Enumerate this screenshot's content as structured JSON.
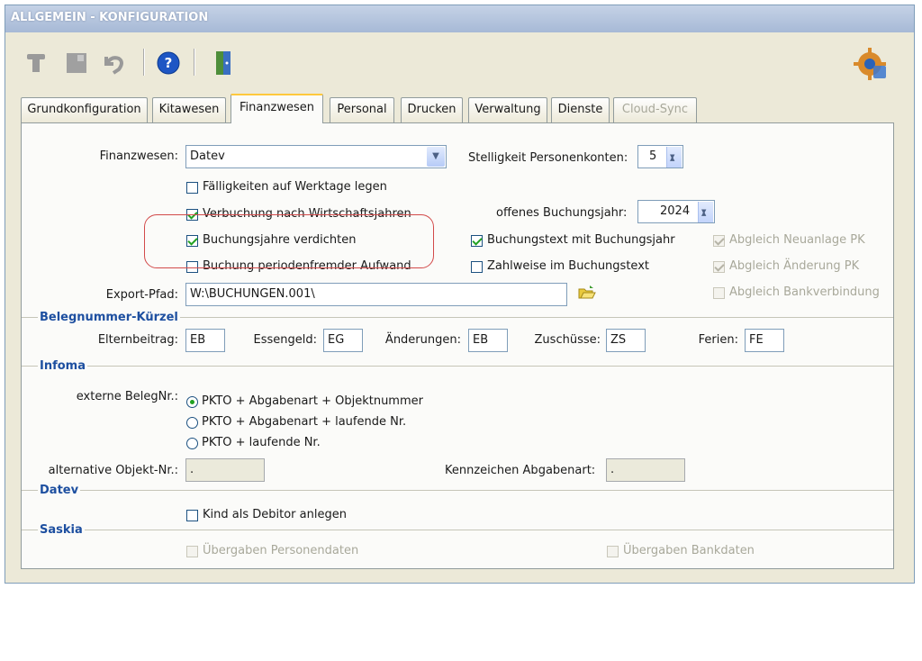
{
  "window": {
    "title": "ALLGEMEIN - KONFIGURATION"
  },
  "toolbar": {
    "icons": [
      "user-icon",
      "save-icon",
      "undo-icon",
      "help-icon",
      "exit-door-icon",
      "settings-gear-icon"
    ]
  },
  "tabs": [
    {
      "label": "Grundkonfiguration",
      "active": false,
      "enabled": true
    },
    {
      "label": "Kitawesen",
      "active": false,
      "enabled": true
    },
    {
      "label": "Finanzwesen",
      "active": true,
      "enabled": true
    },
    {
      "label": "Personal",
      "active": false,
      "enabled": true
    },
    {
      "label": "Drucken",
      "active": false,
      "enabled": true
    },
    {
      "label": "Verwaltung",
      "active": false,
      "enabled": true
    },
    {
      "label": "Dienste",
      "active": false,
      "enabled": true
    },
    {
      "label": "Cloud-Sync",
      "active": false,
      "enabled": false
    }
  ],
  "finanz": {
    "finanzwesen_label": "Finanzwesen:",
    "finanzwesen_value": "Datev",
    "stelligkeit_label": "Stelligkeit Personenkonten:",
    "stelligkeit_value": "5",
    "faelligkeiten_label": "Fälligkeiten auf Werktage legen",
    "faelligkeiten_checked": false,
    "verbuchung_label": "Verbuchung nach Wirtschaftsjahren",
    "verbuchung_checked": true,
    "buchungsjahr_label": "offenes Buchungsjahr:",
    "buchungsjahr_value": "2024",
    "verdichten_label": "Buchungsjahre verdichten",
    "verdichten_checked": true,
    "buchungstext_label": "Buchungstext mit Buchungsjahr",
    "buchungstext_checked": true,
    "abgleich_neuanlage_label": "Abgleich Neuanlage PK",
    "periodenfremd_label": "Buchung periodenfremder Aufwand",
    "periodenfremd_checked": false,
    "zahlweise_label": "Zahlweise im Buchungstext",
    "zahlweise_checked": false,
    "abgleich_aenderung_label": "Abgleich Änderung PK",
    "export_label": "Export-Pfad:",
    "export_value": "W:\\BUCHUNGEN.001\\",
    "abgleich_bank_label": "Abgleich Bankverbindung"
  },
  "beleg": {
    "title": "Belegnummer-Kürzel",
    "elternbeitrag_label": "Elternbeitrag:",
    "elternbeitrag_value": "EB",
    "essengeld_label": "Essengeld:",
    "essengeld_value": "EG",
    "aenderungen_label": "Änderungen:",
    "aenderungen_value": "EB",
    "zuschuesse_label": "Zuschüsse:",
    "zuschuesse_value": "ZS",
    "ferien_label": "Ferien:",
    "ferien_value": "FE"
  },
  "infoma": {
    "title": "Infoma",
    "externe_label": "externe BelegNr.:",
    "options": [
      "PKTO + Abgabenart + Objektnummer",
      "PKTO + Abgabenart + laufende Nr.",
      "PKTO + laufende Nr."
    ],
    "selected": 0,
    "alt_objekt_label": "alternative Objekt-Nr.:",
    "alt_objekt_value": ".",
    "kennzeichen_label": "Kennzeichen Abgabenart:",
    "kennzeichen_value": "."
  },
  "datev": {
    "title": "Datev",
    "kind_label": "Kind als Debitor anlegen",
    "kind_checked": false
  },
  "saskia": {
    "title": "Saskia",
    "personendaten_label": "Übergaben Personendaten",
    "bankdaten_label": "Übergaben Bankdaten"
  }
}
